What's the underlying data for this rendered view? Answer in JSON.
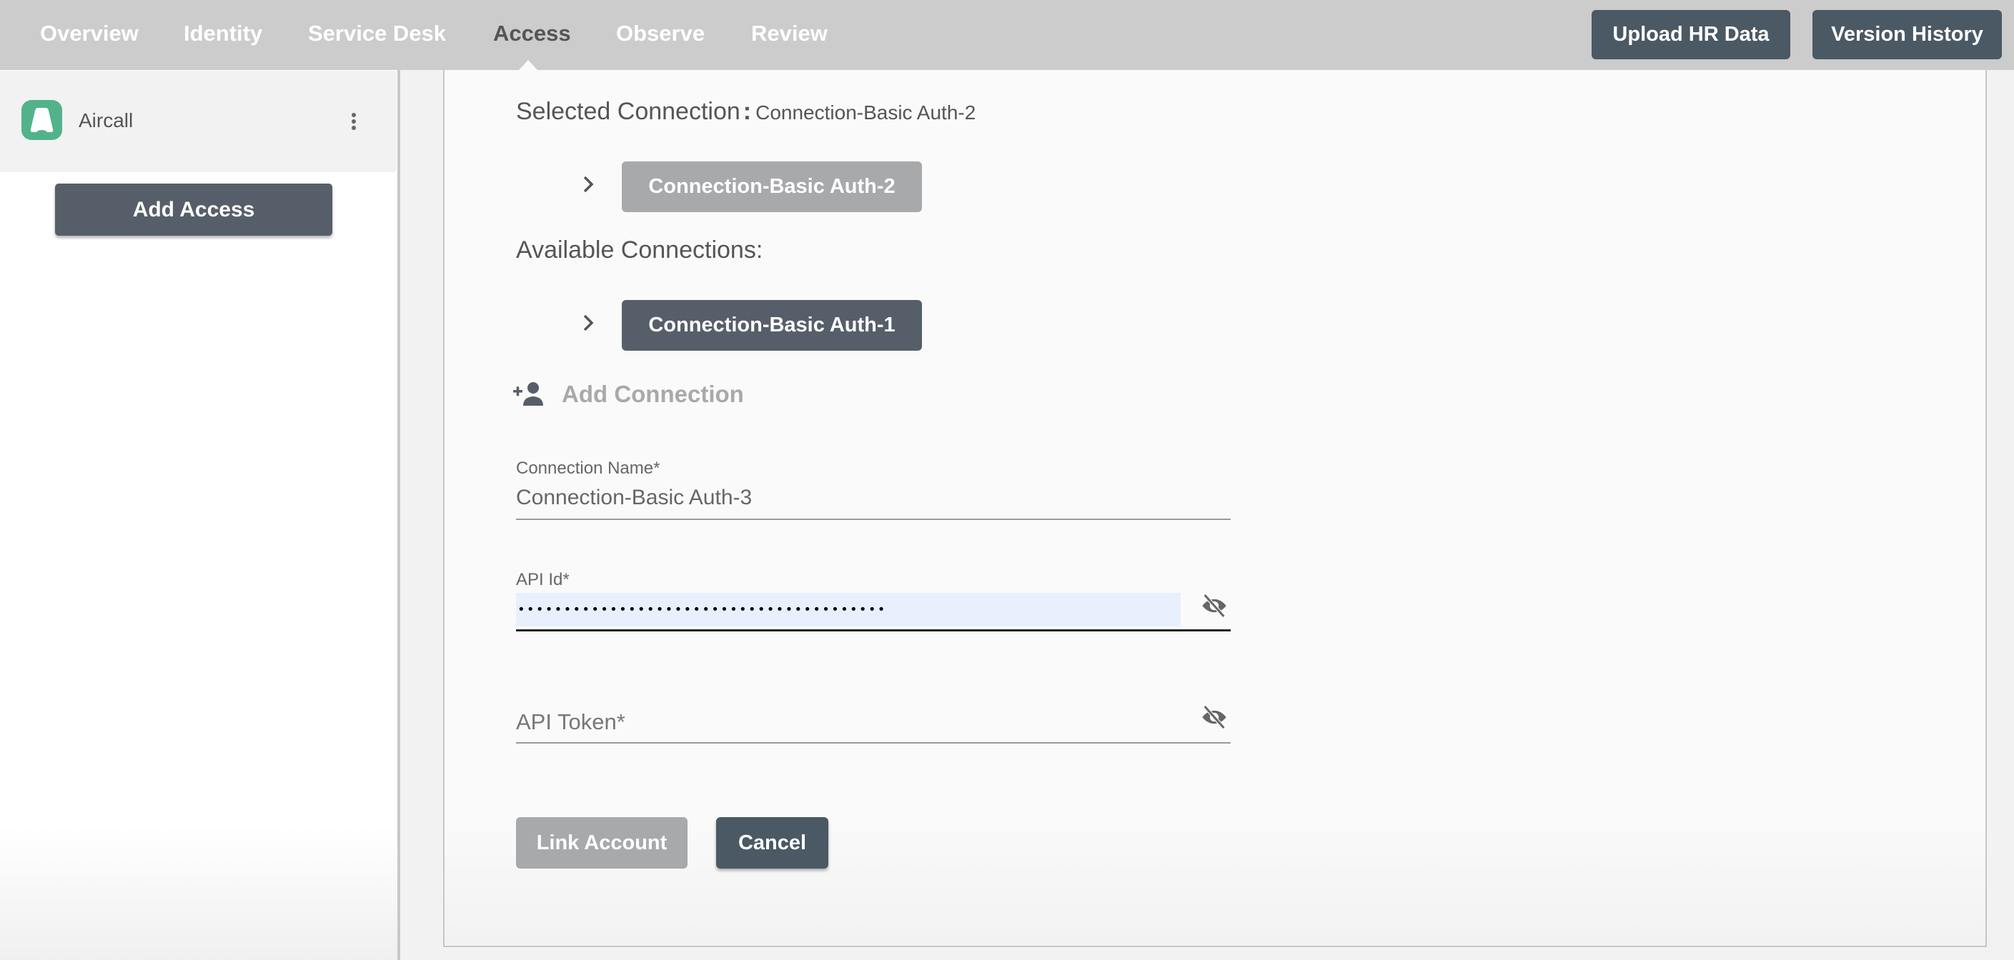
{
  "topnav": {
    "items": [
      {
        "label": "Overview",
        "active": false
      },
      {
        "label": "Identity",
        "active": false
      },
      {
        "label": "Service Desk",
        "active": false
      },
      {
        "label": "Access",
        "active": true
      },
      {
        "label": "Observe",
        "active": false
      },
      {
        "label": "Review",
        "active": false
      }
    ],
    "buttons": {
      "upload_hr": "Upload HR Data",
      "version_history": "Version History"
    }
  },
  "sidebar": {
    "app": {
      "name": "Aircall",
      "logo_icon": "aircall-logo",
      "logo_color": "#52b38b"
    },
    "add_access_label": "Add Access"
  },
  "main": {
    "selected_connection": {
      "title": "Selected Connection",
      "separator": ":",
      "value": "Connection-Basic Auth-2",
      "button_label": "Connection-Basic Auth-2"
    },
    "available_connections": {
      "title": "Available Connections:",
      "items": [
        {
          "label": "Connection-Basic Auth-1"
        }
      ]
    },
    "add_connection_label": "Add Connection",
    "form": {
      "connection_name": {
        "label": "Connection Name*",
        "value": "Connection-Basic Auth-3"
      },
      "api_id": {
        "label": "API Id*",
        "value": "••••••••••••••••••••••••••••••••••••••••",
        "masked": true
      },
      "api_token": {
        "placeholder": "API Token*",
        "value": ""
      }
    },
    "actions": {
      "link_account": "Link Account",
      "cancel": "Cancel"
    }
  },
  "colors": {
    "topbar_bg": "#cccccc",
    "primary_button": "#4a5964",
    "disabled_button": "#a8a9ab",
    "autofill_bg": "#e8f0fe"
  }
}
